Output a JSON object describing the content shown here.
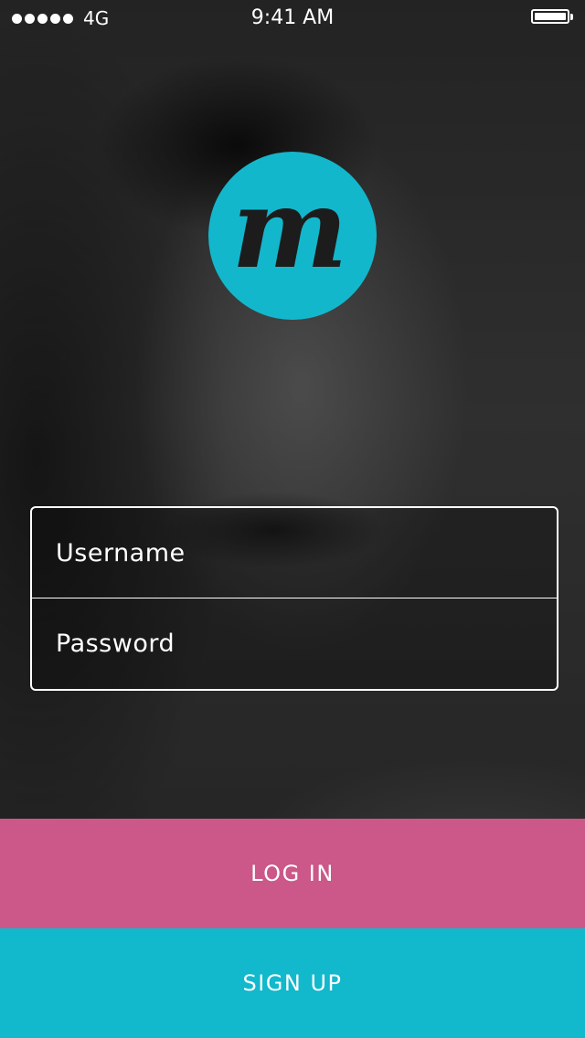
{
  "status_bar": {
    "carrier": "4G",
    "time": "9:41 AM",
    "signal_bars": 5,
    "battery_level": 1.0
  },
  "logo": {
    "letter": "m",
    "color": "#13b7cc"
  },
  "form": {
    "username_placeholder": "Username",
    "password_placeholder": "Password"
  },
  "buttons": {
    "login_label": "LOG IN",
    "login_color": "#cb5889",
    "signup_label": "SIGN UP",
    "signup_color": "#12b8cc"
  }
}
